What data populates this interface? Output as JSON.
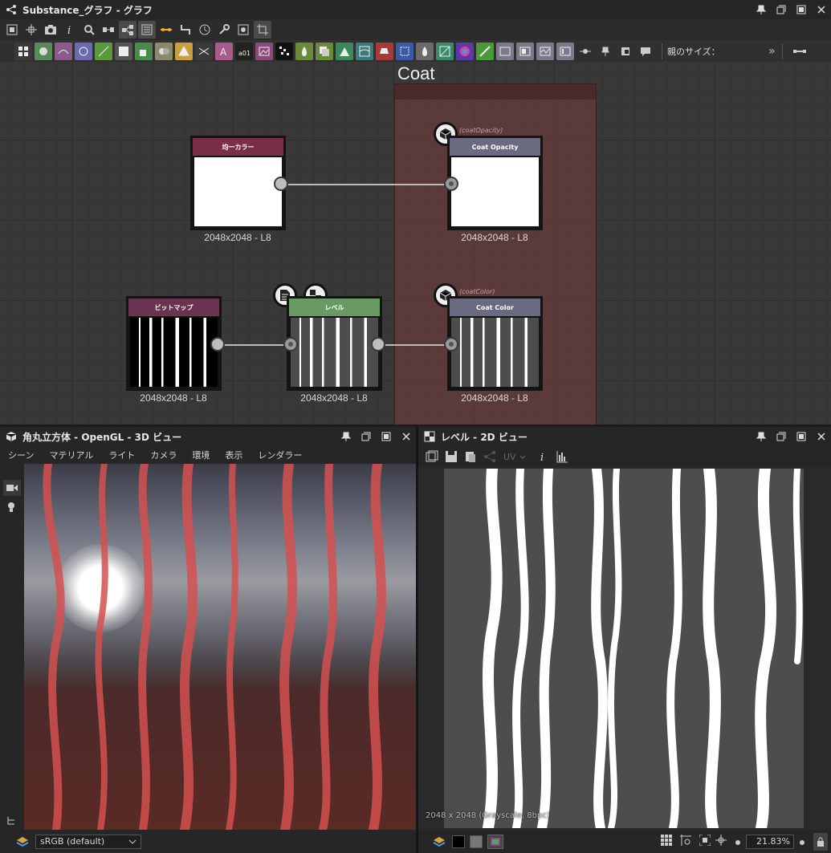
{
  "graph_panel": {
    "title": "Substance_グラフ - グラフ",
    "size_label": "親のサイズ：",
    "more_label": "»",
    "frame_title": "Coat",
    "nodes": [
      {
        "title": "均一カラー",
        "label": "2048x2048 - L8",
        "header_color": "#7a2f46"
      },
      {
        "title": "Coat Opacity",
        "label": "2048x2048 - L8",
        "var": "(coatOpacity)",
        "header_color": "#6a6a80"
      },
      {
        "title": "ビットマップ",
        "label": "2048x2048 - L8",
        "header_color": "#6a3450"
      },
      {
        "title": "レベル",
        "label": "2048x2048 - L8",
        "header_color": "#6a9a64"
      },
      {
        "title": "Coat Color",
        "label": "2048x2048 - L8",
        "var": "(coatColor)",
        "header_color": "#6a6a80"
      }
    ]
  },
  "view3d": {
    "title": "角丸立方体 - OpenGL - 3D ビュー",
    "menu": [
      "シーン",
      "マテリアル",
      "ライト",
      "カメラ",
      "環境",
      "表示",
      "レンダラー"
    ],
    "colorspace": "sRGB (default)"
  },
  "view2d": {
    "title": "レベル - 2D ビュー",
    "uv_label": "UV",
    "info_text": "2048 x 2048 (Grayscale, 8bpc)",
    "zoom": "21.83%"
  }
}
